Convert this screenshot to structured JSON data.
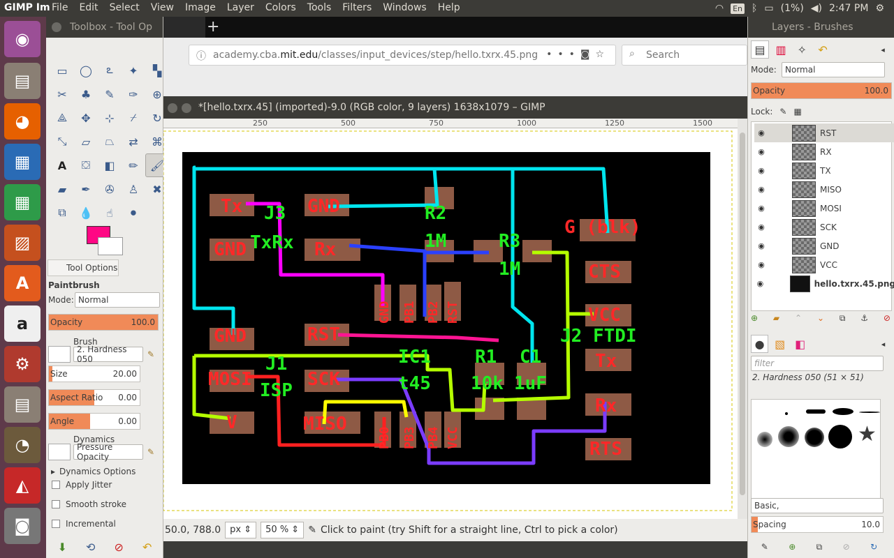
{
  "topbar": {
    "app_name": "GIMP Im",
    "menus": [
      "File",
      "Edit",
      "Select",
      "View",
      "Image",
      "Layer",
      "Colors",
      "Tools",
      "Filters",
      "Windows",
      "Help"
    ],
    "keyboard": "En",
    "battery": "(1%)",
    "time": "2:47 PM"
  },
  "toolbox": {
    "title": "Toolbox - Tool Op",
    "fg_color": "#ff0784",
    "bg_color": "#ffffff",
    "tab_label": "Tool Options",
    "tool_name": "Paintbrush",
    "mode_label": "Mode:",
    "mode_value": "Normal",
    "opacity_label": "Opacity",
    "opacity_value": "100.0",
    "brush_label": "Brush",
    "brush_value": "2. Hardness 050",
    "size_label": "Size",
    "size_value": "20.00",
    "aspect_label": "Aspect Ratio",
    "aspect_value": "0.00",
    "angle_label": "Angle",
    "angle_value": "0.00",
    "dynamics_label": "Dynamics",
    "dynamics_value": "Pressure Opacity",
    "dynamics_options": "Dynamics Options",
    "apply_jitter": "Apply Jitter",
    "smooth_stroke": "Smooth stroke",
    "incremental": "Incremental"
  },
  "browser": {
    "url_prefix": "academy.cba.",
    "url_host": "mit.edu",
    "url_path": "/classes/input_devices/step/hello.txrx.45.png",
    "search_placeholder": "Search"
  },
  "image_window": {
    "title": "*[hello.txrx.45] (imported)-9.0 (RGB color, 9 layers) 1638x1079 – GIMP",
    "ruler_ticks": [
      "250",
      "500",
      "750",
      "1000",
      "1250",
      "1500"
    ],
    "coords": "50.0, 788.0",
    "unit": "px",
    "zoom": "50 %",
    "status_message": "Click to paint (try Shift for a straight line, Ctrl to pick a color)"
  },
  "board_labels": {
    "tx": "Tx",
    "gnd1": "GND",
    "j3": "J3",
    "txrx": "TxRx",
    "r2": "R2",
    "r2v": "1M",
    "r3": "R3",
    "r3v": "1M",
    "gblk": "G (blk)",
    "gnd2": "GND",
    "rx": "Rx",
    "cts": "CTS",
    "gnd_rot": "GND",
    "pb1": "PB1",
    "pb2": "PB2",
    "rst_rot": "RST",
    "vcc": "VCC",
    "gnd3": "GND",
    "rst": "RST",
    "ic1": "IC1",
    "t45": "t45",
    "r1": "R1",
    "r1v": "10k",
    "c1": "C1",
    "c1v": "1uF",
    "j2": "J2 FTDI",
    "tx2": "Tx",
    "mosi": "MOSI",
    "j1": "J1",
    "isp": "ISP",
    "sck": "SCK",
    "rx2": "Rx",
    "v": "V",
    "miso": "MISO",
    "rts": "RTS",
    "pb0": "PB0",
    "pb3": "PB3",
    "pb4": "PB4",
    "vcc_rot": "VCC"
  },
  "layers_panel": {
    "title": "Layers - Brushes",
    "mode_label": "Mode:",
    "mode_value": "Normal",
    "opacity_label": "Opacity",
    "opacity_value": "100.0",
    "lock_label": "Lock:",
    "layers": [
      "RST",
      "RX",
      "TX",
      "MISO",
      "MOSI",
      "SCK",
      "GND",
      "VCC",
      "hello.txrx.45.png"
    ],
    "filter_placeholder": "filter",
    "brush_name": "2. Hardness 050 (51 × 51)",
    "brush_set": "Basic,",
    "spacing_label": "Spacing",
    "spacing_value": "10.0"
  }
}
